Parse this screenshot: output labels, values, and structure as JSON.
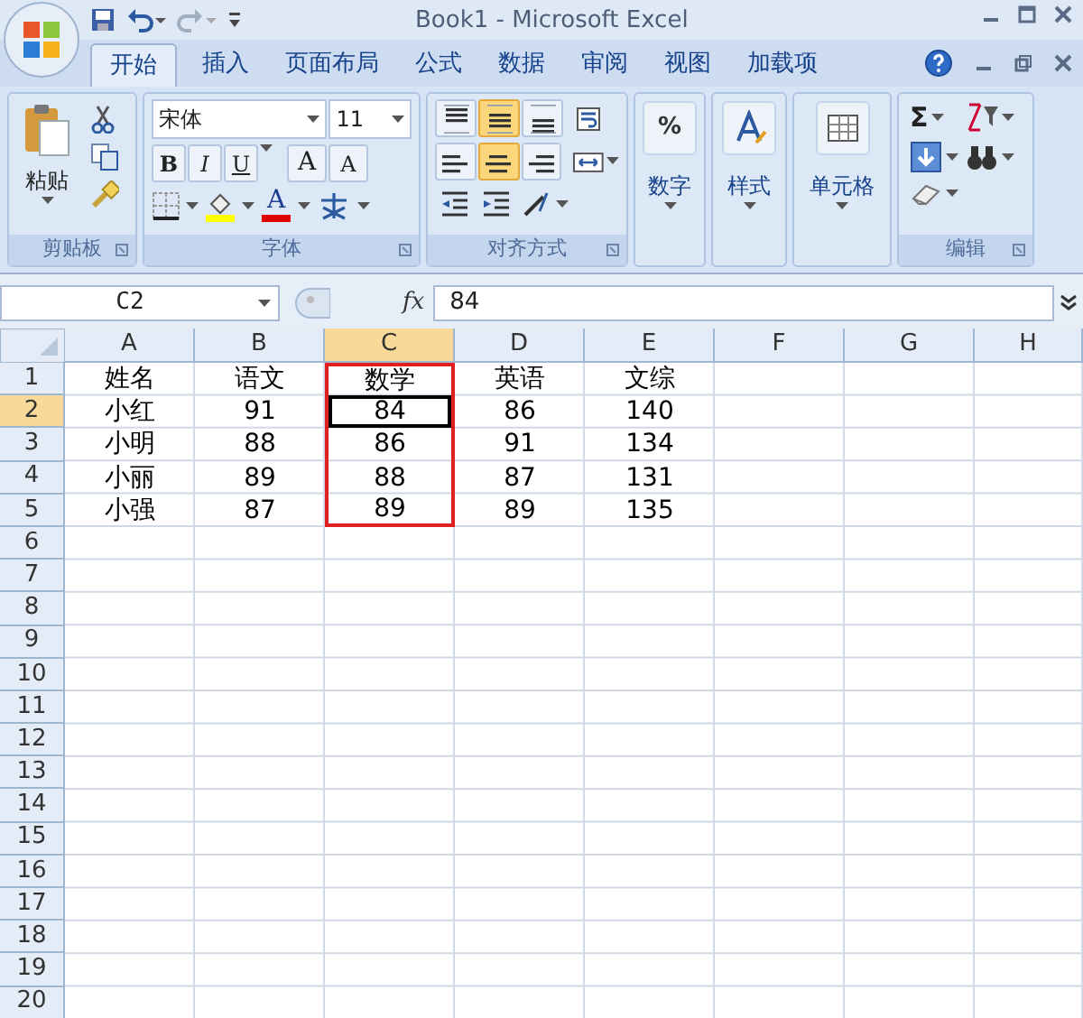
{
  "window": {
    "title": "Book1 - Microsoft Excel"
  },
  "tabs": [
    {
      "label": "开始",
      "selected": true
    },
    {
      "label": "插入",
      "selected": false
    },
    {
      "label": "页面布局",
      "selected": false
    },
    {
      "label": "公式",
      "selected": false
    },
    {
      "label": "数据",
      "selected": false
    },
    {
      "label": "审阅",
      "selected": false
    },
    {
      "label": "视图",
      "selected": false
    },
    {
      "label": "加载项",
      "selected": false
    }
  ],
  "ribbon": {
    "clipboard": {
      "paste_label": "粘贴",
      "group_label": "剪贴板"
    },
    "font": {
      "font_name": "宋体",
      "font_size": "11",
      "style_buttons": [
        "B",
        "I",
        "U"
      ],
      "size_buttons": [
        "A",
        "A"
      ],
      "font_color_label": "A",
      "group_label": "字体"
    },
    "alignment": {
      "vertical_options": [
        {
          "selected": false
        },
        {
          "selected": true
        },
        {
          "selected": false
        }
      ],
      "horizontal_options": [
        {
          "selected": false
        },
        {
          "selected": true
        },
        {
          "selected": false
        }
      ],
      "group_label": "对齐方式"
    },
    "number": {
      "symbol": "%",
      "label": "数字"
    },
    "styles": {
      "label": "样式"
    },
    "cells": {
      "label": "单元格"
    },
    "editing": {
      "sum_symbol": "Σ",
      "group_label": "编辑"
    }
  },
  "formula_bar": {
    "name_box": "C2",
    "function_label": "fx",
    "value": "84"
  },
  "sheet": {
    "columns": [
      {
        "label": "A",
        "selected": false
      },
      {
        "label": "B",
        "selected": false
      },
      {
        "label": "C",
        "selected": true
      },
      {
        "label": "D",
        "selected": false
      },
      {
        "label": "E",
        "selected": false
      },
      {
        "label": "F",
        "selected": false
      },
      {
        "label": "G",
        "selected": false
      },
      {
        "label": "H",
        "selected": false
      }
    ],
    "rows": [
      {
        "label": "1",
        "selected": false,
        "cells": [
          {
            "text": "姓名",
            "highlighted": false,
            "active": false
          },
          {
            "text": "语文",
            "highlighted": false,
            "active": false
          },
          {
            "text": "数学",
            "highlighted": true,
            "active": false
          },
          {
            "text": "英语",
            "highlighted": false,
            "active": false
          },
          {
            "text": "文综",
            "highlighted": false,
            "active": false
          }
        ]
      },
      {
        "label": "2",
        "selected": true,
        "cells": [
          {
            "text": "小红",
            "highlighted": false,
            "active": false
          },
          {
            "text": "91",
            "highlighted": false,
            "active": false
          },
          {
            "text": "84",
            "highlighted": true,
            "active": true
          },
          {
            "text": "86",
            "highlighted": false,
            "active": false
          },
          {
            "text": "140",
            "highlighted": false,
            "active": false
          }
        ]
      },
      {
        "label": "3",
        "selected": false,
        "cells": [
          {
            "text": "小明",
            "highlighted": false,
            "active": false
          },
          {
            "text": "88",
            "highlighted": false,
            "active": false
          },
          {
            "text": "86",
            "highlighted": true,
            "active": false
          },
          {
            "text": "91",
            "highlighted": false,
            "active": false
          },
          {
            "text": "134",
            "highlighted": false,
            "active": false
          }
        ]
      },
      {
        "label": "4",
        "selected": false,
        "cells": [
          {
            "text": "小丽",
            "highlighted": false,
            "active": false
          },
          {
            "text": "89",
            "highlighted": false,
            "active": false
          },
          {
            "text": "88",
            "highlighted": true,
            "active": false
          },
          {
            "text": "87",
            "highlighted": false,
            "active": false
          },
          {
            "text": "131",
            "highlighted": false,
            "active": false
          }
        ]
      },
      {
        "label": "5",
        "selected": false,
        "cells": [
          {
            "text": "小强",
            "highlighted": false,
            "active": false
          },
          {
            "text": "87",
            "highlighted": false,
            "active": false
          },
          {
            "text": "89",
            "highlighted": true,
            "active": false
          },
          {
            "text": "89",
            "highlighted": false,
            "active": false
          },
          {
            "text": "135",
            "highlighted": false,
            "active": false
          }
        ]
      },
      {
        "label": "6",
        "selected": false
      },
      {
        "label": "7",
        "selected": false
      },
      {
        "label": "8",
        "selected": false
      },
      {
        "label": "9",
        "selected": false
      },
      {
        "label": "10",
        "selected": false
      },
      {
        "label": "11",
        "selected": false
      },
      {
        "label": "12",
        "selected": false
      },
      {
        "label": "13",
        "selected": false
      },
      {
        "label": "14",
        "selected": false
      },
      {
        "label": "15",
        "selected": false
      },
      {
        "label": "16",
        "selected": false
      },
      {
        "label": "17",
        "selected": false
      },
      {
        "label": "18",
        "selected": false
      },
      {
        "label": "19",
        "selected": false
      },
      {
        "label": "20",
        "selected": false
      }
    ]
  }
}
